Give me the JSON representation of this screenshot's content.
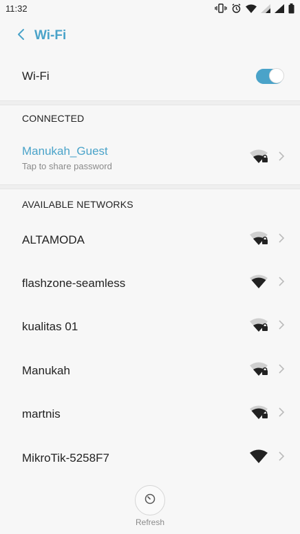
{
  "status_bar": {
    "time": "11:32"
  },
  "header": {
    "title": "Wi-Fi"
  },
  "wifi_toggle": {
    "label": "Wi-Fi",
    "state": "on"
  },
  "connected": {
    "section_title": "CONNECTED",
    "network": {
      "name": "Manukah_Guest",
      "subtitle": "Tap to share password",
      "secured": true
    }
  },
  "available": {
    "section_title": "AVAILABLE NETWORKS",
    "networks": [
      {
        "name": "ALTAMODA",
        "secured": true,
        "signal": "medium"
      },
      {
        "name": "flashzone-seamless",
        "secured": false,
        "signal": "strong"
      },
      {
        "name": "kualitas 01",
        "secured": true,
        "signal": "medium"
      },
      {
        "name": "Manukah",
        "secured": true,
        "signal": "medium"
      },
      {
        "name": "martnis",
        "secured": true,
        "signal": "strong"
      },
      {
        "name": "MikroTik-5258F7",
        "secured": false,
        "signal": "full"
      }
    ]
  },
  "refresh": {
    "label": "Refresh"
  },
  "colors": {
    "accent": "#4aa3c9",
    "icon": "#222222",
    "muted": "#cccccc"
  }
}
